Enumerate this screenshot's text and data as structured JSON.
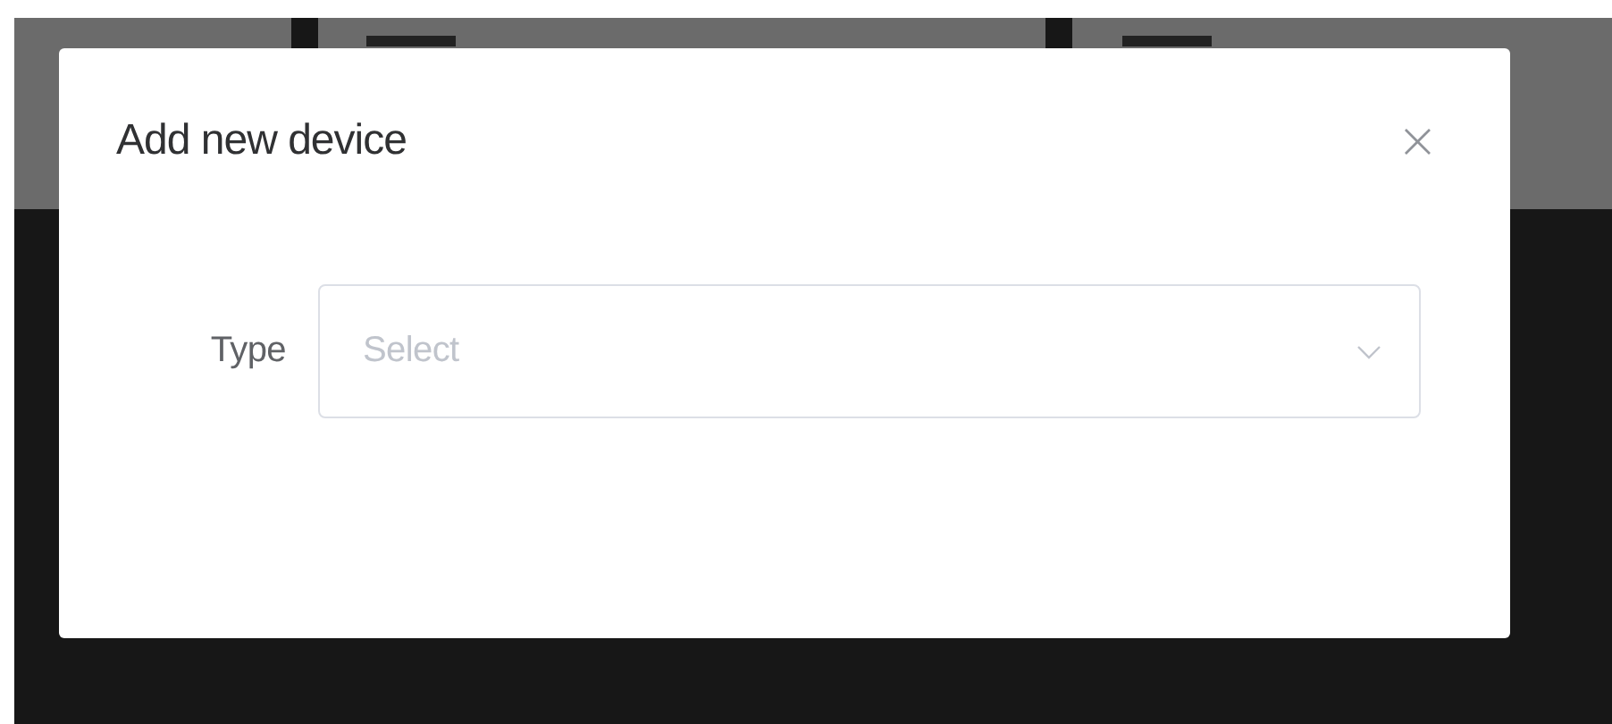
{
  "dialog": {
    "title": "Add new device",
    "close_icon": "×",
    "fields": [
      {
        "label": "Type",
        "placeholder": "Select"
      }
    ]
  }
}
